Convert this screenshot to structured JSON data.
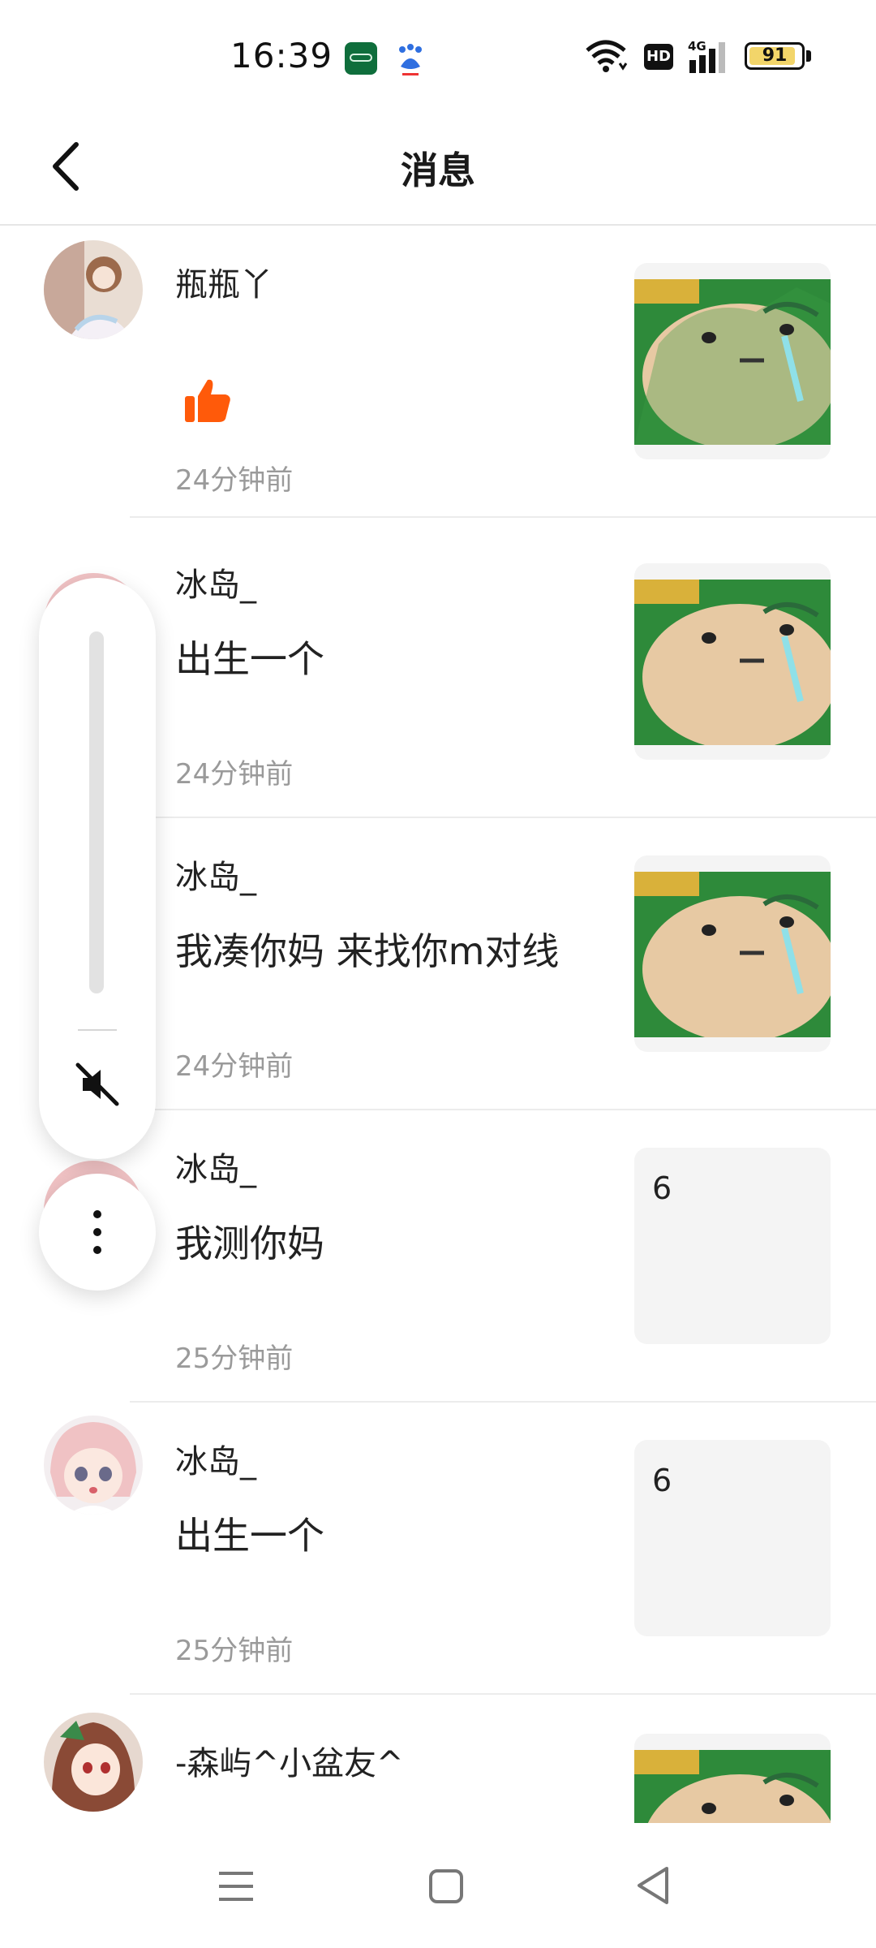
{
  "status_bar": {
    "time": "16:39",
    "battery": "91",
    "battery_level": 0.91,
    "icons": [
      "oppo-app-icon",
      "baidu-app-icon",
      "wifi-icon",
      "hd-icon",
      "signal-4g-icon",
      "battery-icon"
    ]
  },
  "header": {
    "title": "消息",
    "back_icon": "chevron-left-icon"
  },
  "messages": [
    {
      "sender": "瓶瓶丫",
      "content": "",
      "content_icon": "thumbs-up-icon",
      "time": "24分钟前",
      "thumb_type": "image"
    },
    {
      "sender": "冰岛_",
      "content": "出生一个",
      "time": "24分钟前",
      "thumb_type": "image"
    },
    {
      "sender": "冰岛_",
      "content": "我凑你妈 来找你m对线",
      "time": "24分钟前",
      "thumb_type": "image"
    },
    {
      "sender": "冰岛_",
      "content": "我测你妈",
      "time": "25分钟前",
      "thumb_type": "text",
      "thumb_text": "6"
    },
    {
      "sender": "冰岛_",
      "content": "出生一个",
      "time": "25分钟前",
      "thumb_type": "text",
      "thumb_text": "6"
    },
    {
      "sender": "-森屿^小盆友^",
      "content": "",
      "time": "",
      "thumb_type": "image"
    }
  ],
  "volume_panel": {
    "level": 0,
    "mute_icon": "speaker-muted-icon",
    "more_icon": "more-vertical-icon"
  },
  "nav_bar": {
    "icons": [
      "menu-icon",
      "home-square-icon",
      "back-triangle-icon"
    ]
  },
  "colors": {
    "accent_like": "#ff5a0a",
    "time_gray": "#9a9a9a",
    "thumb_bg": "#f4f4f4"
  }
}
